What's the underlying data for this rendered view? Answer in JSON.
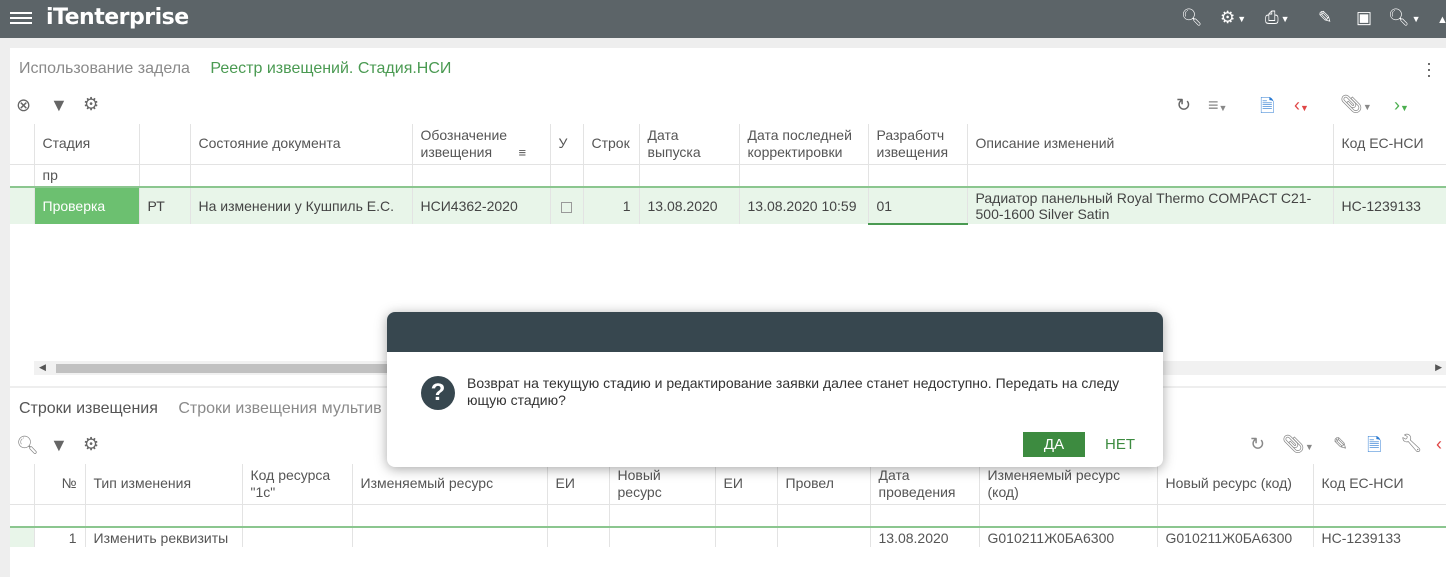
{
  "app": {
    "logo_text": "enterprise",
    "logo_mark": "iT"
  },
  "top_panel": {
    "tabs": [
      {
        "label": "Использование задела"
      },
      {
        "label": "Реестр извещений. Стадия.НСИ"
      }
    ],
    "columns": [
      "Стадия",
      "",
      "Состояние документа",
      "Обозначение извещения",
      "У",
      "Строк",
      "Дата выпуска",
      "Дата последней корректировки",
      "Разработч извещения",
      "Описание изменений",
      "Код ЕС-НСИ"
    ],
    "filter_value": "пр",
    "row": {
      "stage": "Проверка",
      "code": "РТ",
      "state": "На изменении у  Кушпиль Е.С.",
      "designation": "НСИ4362-2020",
      "count": "1",
      "release_date": "13.08.2020",
      "last_edit": "13.08.2020 10:59",
      "developer": "01",
      "description": "Радиатор панельный Royal Thermo COMPACT C21-500-1600 Silver Satin",
      "es_code": "НС-1239133"
    }
  },
  "bottom_panel": {
    "tabs": [
      {
        "label": "Строки извещения"
      },
      {
        "label": "Строки извещения мультив"
      }
    ],
    "columns": [
      "№",
      "Тип изменения",
      "Код ресурса \"1с\"",
      "Изменяемый ресурс",
      "ЕИ",
      "Новый ресурс",
      "ЕИ",
      "Провел",
      "Дата проведения",
      "Изменяемый ресурс (код)",
      "Новый ресурс (код)",
      "Код ЕС-НСИ"
    ],
    "row": {
      "num": "1",
      "type": "Изменить реквизиты",
      "date": "13.08.2020",
      "old_code": "G010211Ж0БА6300",
      "new_code": "G010211Ж0БА6300",
      "es_code": "НС-1239133"
    }
  },
  "dialog": {
    "message": "Возврат на текущую стадию и редактирование заявки далее станет недоступно. Передать на следу ющую стадию?",
    "yes_label": "ДА",
    "no_label": "НЕТ",
    "question_mark": "?"
  },
  "colors": {
    "topbar": "#5c6468",
    "accent_green": "#4a9a52",
    "selected_cell": "#6cc070",
    "dialog_header": "#37474f"
  }
}
